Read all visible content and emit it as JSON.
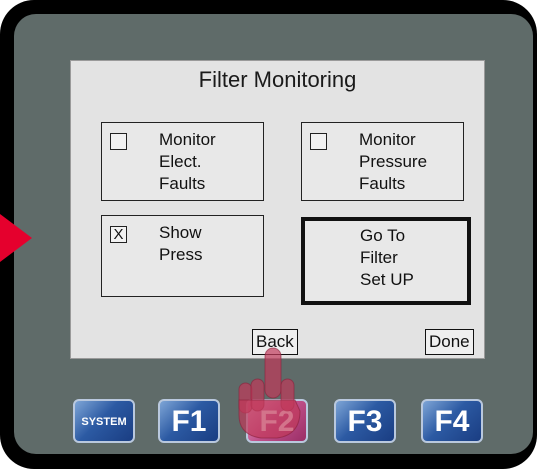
{
  "screen": {
    "title": "Filter Monitoring",
    "options": [
      {
        "checked": "",
        "label": "Monitor\nElect.\nFaults"
      },
      {
        "checked": "",
        "label": "Monitor\nPressure\nFaults"
      },
      {
        "checked": "X",
        "label": "Show\nPress"
      }
    ],
    "goto_label": "Go To\nFilter\nSet UP",
    "back_label": "Back",
    "done_label": "Done"
  },
  "function_keys": [
    {
      "label": "SYSTEM"
    },
    {
      "label": "F1"
    },
    {
      "label": "F2",
      "highlighted": true
    },
    {
      "label": "F3"
    },
    {
      "label": "F4"
    }
  ],
  "colors": {
    "bezel": "#5f6b69",
    "screen": "#e3e3e3",
    "key_blue": "#2c5aa3",
    "key_pressed": "#c0508a",
    "arrow": "#e5002d"
  },
  "icons": [
    "pointing-hand-icon",
    "arrow-indicator-icon"
  ]
}
